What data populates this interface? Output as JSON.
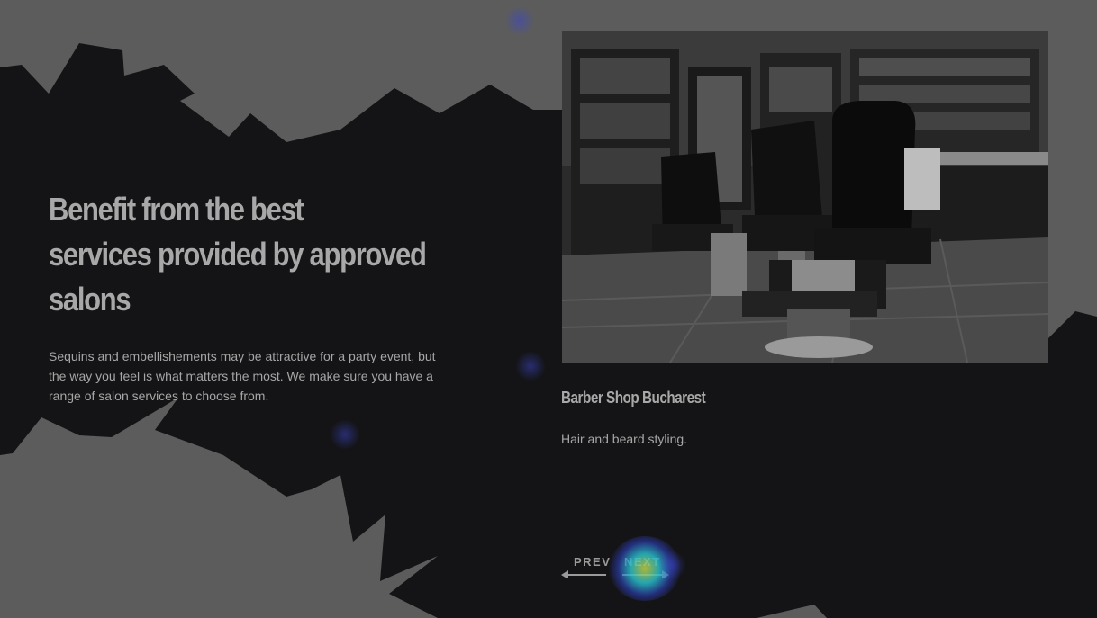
{
  "hero": {
    "heading_lines": [
      "Benefit from the best",
      "services provided by approved",
      "salons"
    ],
    "intro": "Sequins and embellishements may be attractive for a party event, but the way you feel is what matters the most. We make sure you have a range of salon services to choose from."
  },
  "card": {
    "image_alt": "Barber shop interior with vintage barber chairs",
    "title": "Barber Shop Bucharest",
    "description": "Hair and beard styling."
  },
  "nav": {
    "prev_label": "PREV",
    "next_label": "NEXT"
  },
  "colors": {
    "background": "#5c5c5c",
    "panel": "#141416",
    "text": "#a6a6a6",
    "heat_focus": "#22c6c6"
  }
}
